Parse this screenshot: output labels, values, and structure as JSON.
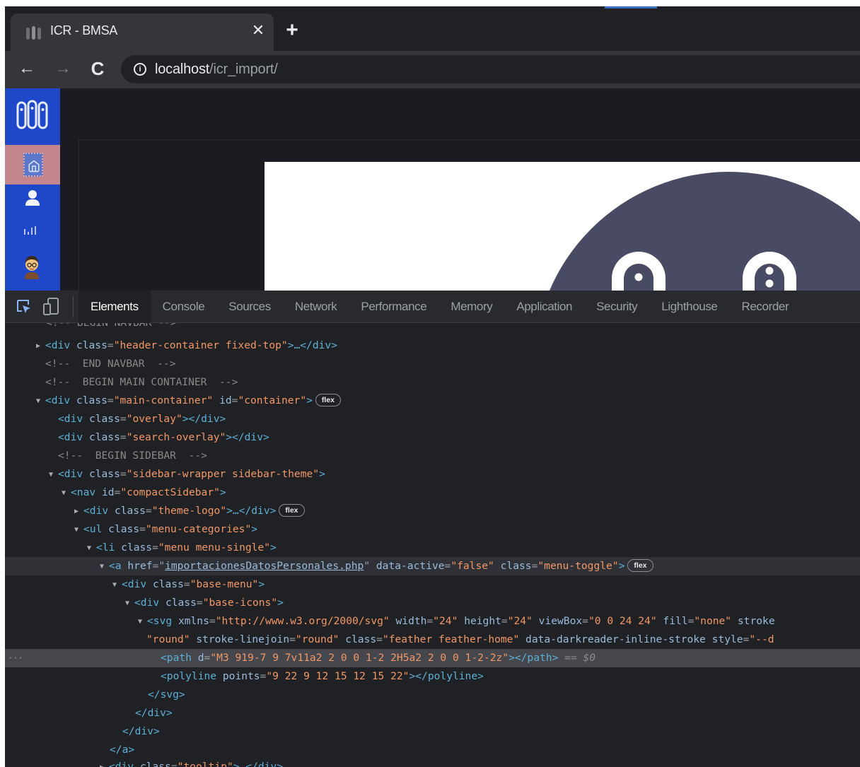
{
  "browser": {
    "tab": {
      "title": "ICR - BMSA",
      "close_glyph": "✕"
    },
    "new_tab_glyph": "+",
    "url_host": "localhost",
    "url_path": "/icr_import/",
    "info_glyph": "i",
    "nav": {
      "back": "←",
      "forward": "→",
      "reload": "C"
    }
  },
  "devtools": {
    "tabs": [
      {
        "label": "Elements",
        "active": true
      },
      {
        "label": "Console",
        "active": false
      },
      {
        "label": "Sources",
        "active": false
      },
      {
        "label": "Network",
        "active": false
      },
      {
        "label": "Performance",
        "active": false
      },
      {
        "label": "Memory",
        "active": false
      },
      {
        "label": "Application",
        "active": false
      },
      {
        "label": "Security",
        "active": false
      },
      {
        "label": "Lighthouse",
        "active": false
      },
      {
        "label": "Recorder",
        "active": false
      }
    ],
    "dom": {
      "l0": {
        "text": "<!-- BEGIN NAVBAR -->"
      },
      "l1": {
        "tag_open": "<div",
        "attr1_name": "class",
        "attr1_value": "\"header-container fixed-top\"",
        "rest": ">…</div>"
      },
      "l2": {
        "text": "<!--  END NAVBAR  -->"
      },
      "l3": {
        "text": "<!--  BEGIN MAIN CONTAINER  -->"
      },
      "l4": {
        "tag_open": "<div",
        "attr1_name": "class",
        "attr1_value": "\"main-container\"",
        "attr2_name": "id",
        "attr2_value": "\"container\"",
        "close": ">",
        "badge": "flex"
      },
      "l5": {
        "tag_open": "<div",
        "attr1_name": "class",
        "attr1_value": "\"overlay\"",
        "rest": "></div>"
      },
      "l6": {
        "tag_open": "<div",
        "attr1_name": "class",
        "attr1_value": "\"search-overlay\"",
        "rest": "></div>"
      },
      "l7": {
        "text": "<!--  BEGIN SIDEBAR  -->"
      },
      "l8": {
        "tag_open": "<div",
        "attr1_name": "class",
        "attr1_value": "\"sidebar-wrapper sidebar-theme\"",
        "close": ">"
      },
      "l9": {
        "tag_open": "<nav",
        "attr1_name": "id",
        "attr1_value": "\"compactSidebar\"",
        "close": ">"
      },
      "l10": {
        "tag_open": "<div",
        "attr1_name": "class",
        "attr1_value": "\"theme-logo\"",
        "rest": ">…</div>",
        "badge": "flex"
      },
      "l11": {
        "tag_open": "<ul",
        "attr1_name": "class",
        "attr1_value": "\"menu-categories\"",
        "close": ">"
      },
      "l12": {
        "tag_open": "<li",
        "attr1_name": "class",
        "attr1_value": "\"menu menu-single\"",
        "close": ">"
      },
      "l13": {
        "tag_open": "<a",
        "attr1_name": "href",
        "attr1_value": "importacionesDatosPersonales.php",
        "attr2_name": "data-active",
        "attr2_value": "\"false\"",
        "attr3_name": "class",
        "attr3_value": "\"menu-toggle\"",
        "close": ">",
        "badge": "flex"
      },
      "l14": {
        "tag_open": "<div",
        "attr1_name": "class",
        "attr1_value": "\"base-menu\"",
        "close": ">"
      },
      "l15": {
        "tag_open": "<div",
        "attr1_name": "class",
        "attr1_value": "\"base-icons\"",
        "close": ">"
      },
      "l16": {
        "tag_open": "<svg",
        "attr1_name": "xmlns",
        "attr1_value": "\"http://www.w3.org/2000/svg\"",
        "attr2_name": "width",
        "attr2_value": "\"24\"",
        "attr3_name": "height",
        "attr3_value": "\"24\"",
        "attr4_name": "viewBox",
        "attr4_value": "\"0 0 24 24\"",
        "attr5_name": "fill",
        "attr5_value": "\"none\"",
        "attr6_name": "stroke"
      },
      "l17": {
        "attr0_value": "\"round\"",
        "attr1_name": "stroke-linejoin",
        "attr1_value": "\"round\"",
        "attr2_name": "class",
        "attr2_value": "\"feather feather-home\"",
        "attr3_name": "data-darkreader-inline-stroke",
        "attr4_name": "style",
        "attr4_value": "\"--d"
      },
      "l18": {
        "tag_open": "<path",
        "attr1_name": "d",
        "attr1_value": "\"M3 919-7 9 7v11a2 2 0 0 1-2 2H5a2 2 0 0 1-2-2z\"",
        "rest": "></path>",
        "marker": " == $0",
        "ellipsis": "···"
      },
      "l19": {
        "tag_open": "<polyline",
        "attr1_name": "points",
        "attr1_value": "\"9 22 9 12 15 12 15 22\"",
        "rest": "></polyline>"
      },
      "l20": {
        "text": "</svg>"
      },
      "l21": {
        "text": "</div>"
      },
      "l22": {
        "text": "</div>"
      },
      "l23": {
        "text": "</a>"
      },
      "l24": {
        "tag_open": "<div",
        "attr1_name": "class",
        "attr1_value": "\"tooltip\"",
        "rest": ">…</div>"
      }
    }
  }
}
